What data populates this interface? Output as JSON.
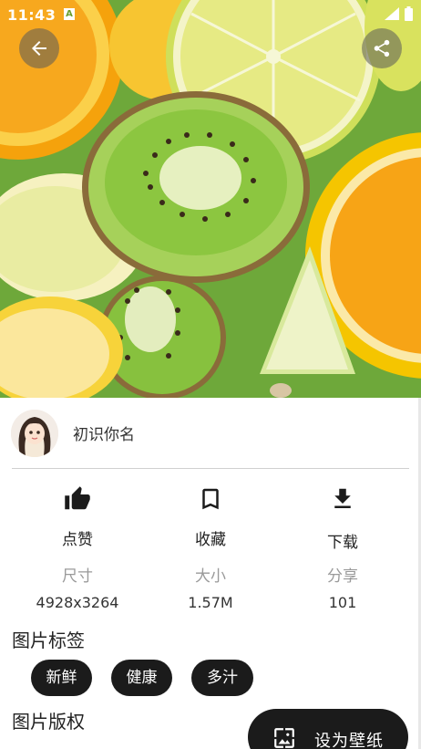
{
  "status_bar": {
    "time": "11:43",
    "notification_icon": "A"
  },
  "header": {
    "back_icon": "arrow-left-icon",
    "share_icon": "share-icon"
  },
  "author": {
    "name": "初识你名",
    "avatar_icon": "avatar"
  },
  "actions": [
    {
      "label": "点赞",
      "icon": "thumb-up-icon"
    },
    {
      "label": "收藏",
      "icon": "bookmark-icon"
    },
    {
      "label": "下载",
      "icon": "download-icon"
    }
  ],
  "meta": {
    "size_label": "尺寸",
    "size_value": "4928x3264",
    "filesize_label": "大小",
    "filesize_value": "1.57M",
    "share_label": "分享",
    "share_value": "101"
  },
  "tags_section": {
    "title": "图片标签",
    "tags": [
      "新鲜",
      "健康",
      "多汁"
    ]
  },
  "copyright_section": {
    "title": "图片版权"
  },
  "wallpaper_button": {
    "label": "设为壁纸",
    "icon": "wallpaper-icon"
  },
  "colors": {
    "button_dark": "#1b1b1b",
    "muted_text": "#9a9a9a",
    "divider": "#d0d0d0"
  }
}
